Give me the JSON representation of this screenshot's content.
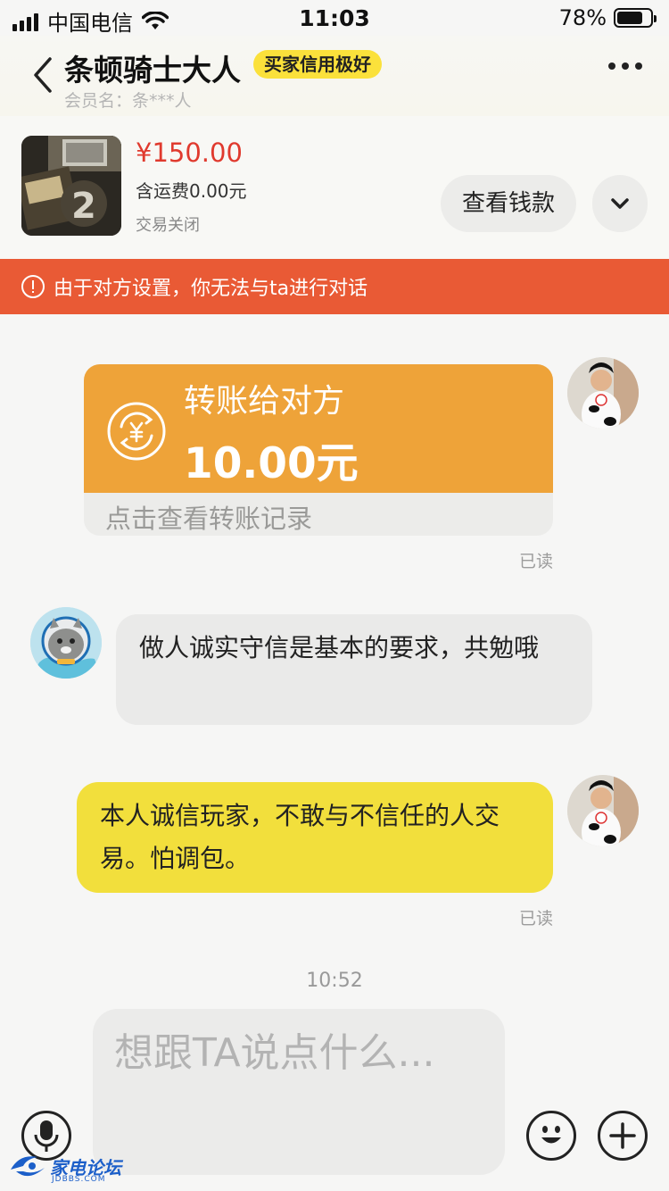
{
  "status_bar": {
    "carrier": "中国电信",
    "time": "11:03",
    "battery_percent": "78%",
    "battery_level": 0.78
  },
  "header": {
    "nickname": "条顿骑士大人",
    "credit_badge": "买家信用极好",
    "member_label": "会员名：条***人"
  },
  "product": {
    "price": "¥150.00",
    "shipping": "含运费0.00元",
    "status": "交易关闭",
    "view_money_label": "查看钱款"
  },
  "banner": {
    "text": "由于对方设置，你无法与ta进行对话",
    "color": "#e95a35"
  },
  "messages": {
    "transfer": {
      "title": "转账给对方",
      "amount": "10.00元",
      "link_text": "点击查看转账记录",
      "read": "已读"
    },
    "other_text": "做人诚实守信是基本的要求，共勉哦",
    "my_text": "本人诚信玩家，不敢与不信任的人交易。怕调包。",
    "my_read": "已读",
    "time_separator": "10:52"
  },
  "input": {
    "placeholder": "想跟TA说点什么..."
  },
  "watermark": {
    "text": "家电论坛",
    "sub": "JDBBS.COM"
  },
  "colors": {
    "accent_yellow": "#f2df3c",
    "transfer_orange": "#eea339",
    "price_red": "#e03a2e"
  }
}
